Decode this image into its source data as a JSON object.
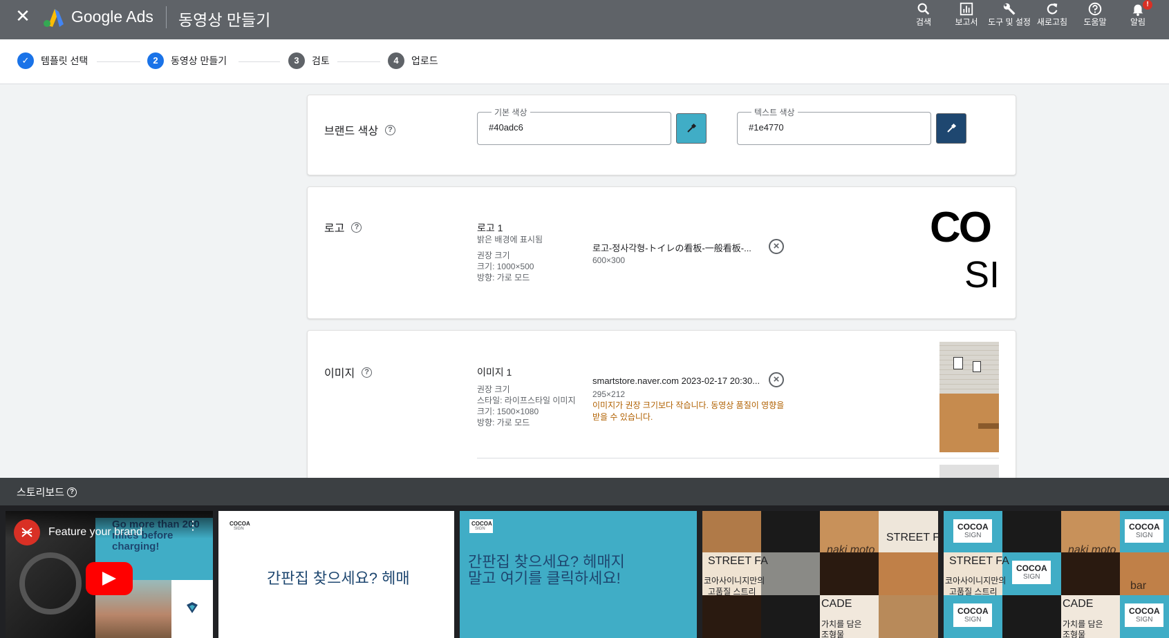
{
  "topbar": {
    "brand": "Google Ads",
    "page_title": "동영상 만들기",
    "tools": [
      {
        "icon": "search-icon",
        "label": "검색"
      },
      {
        "icon": "reports-icon",
        "label": "보고서"
      },
      {
        "icon": "wrench-icon",
        "label": "도구 및 설정"
      },
      {
        "icon": "refresh-icon",
        "label": "새로고침"
      },
      {
        "icon": "help-icon",
        "label": "도움말"
      },
      {
        "icon": "bell-icon",
        "label": "알림",
        "badge": "!"
      }
    ]
  },
  "stepper": {
    "steps": [
      {
        "num": "✓",
        "label": "템플릿 선택",
        "state": "done"
      },
      {
        "num": "2",
        "label": "동영상 만들기",
        "state": "active"
      },
      {
        "num": "3",
        "label": "검토",
        "state": "todo"
      },
      {
        "num": "4",
        "label": "업로드",
        "state": "todo"
      }
    ]
  },
  "brand_color": {
    "title": "브랜드 색상",
    "primary": {
      "label": "기본 색상",
      "value": "#40adc6",
      "swatch": "#40adc6"
    },
    "text": {
      "label": "텍스트 색상",
      "value": "#1e4770",
      "swatch": "#1e4770"
    }
  },
  "logo": {
    "title": "로고",
    "asset_title": "로고 1",
    "asset_desc": "밝은 배경에 표시됨",
    "rec_title": "권장 크기",
    "rec_size": "크기: 1000×500",
    "rec_orientation": "방향: 가로 모드",
    "file_name": "로고-정사각형-トイレの看板-一般看板-...",
    "file_dim": "600×300",
    "preview_text_1": "CO",
    "preview_text_2": "SI"
  },
  "image": {
    "title": "이미지",
    "asset_title": "이미지 1",
    "rec_title": "권장 크기",
    "rec_style": "스타일: 라이프스타일 이미지",
    "rec_size": "크기: 1500×1080",
    "rec_orientation": "방향: 가로 모드",
    "file_name": "smartstore.naver.com 2023-02-17 20:30...",
    "file_dim": "295×212",
    "warning": "이미지가 권장 크기보다 작습니다. 동영상 품질이 영향을 받을 수 있습니다."
  },
  "storyboard": {
    "title": "스토리보드",
    "video": {
      "title": "Feature your brand",
      "overlay_text": "Go more than 200 miles before charging!"
    },
    "frame2": {
      "logo_top": "COCOA",
      "logo_bottom": "SIGN",
      "headline": "간판집 찾으세요? 헤매"
    },
    "frame3": {
      "logo_top": "COCOA",
      "logo_bottom": "SIGN",
      "headline": "간판집 찾으세요? 헤매지말고 여기를 클릭하세요!"
    },
    "frame4": {
      "street": "STREET FA",
      "street2": "STREET FA",
      "kr1": "코아사이니지만의",
      "kr2": "고품질 스트리",
      "cade": "CADE",
      "kr3": "가치를 담은",
      "kr4": "조형물",
      "maki": "naki moto"
    },
    "frame5": {
      "logo_top": "COCOA",
      "logo_bottom": "SIGN",
      "street": "STREET FA",
      "kr1": "코아사이니지만의",
      "kr2": "고품질 스트리",
      "cade": "CADE",
      "kr3": "가치를 담은",
      "kr4": "조형물",
      "maki": "naki moto",
      "bar": "bar"
    }
  },
  "colors": {
    "topbar": "#5f6368",
    "blue": "#1a73e8",
    "accent": "#40adc6",
    "navy": "#1e4770"
  }
}
